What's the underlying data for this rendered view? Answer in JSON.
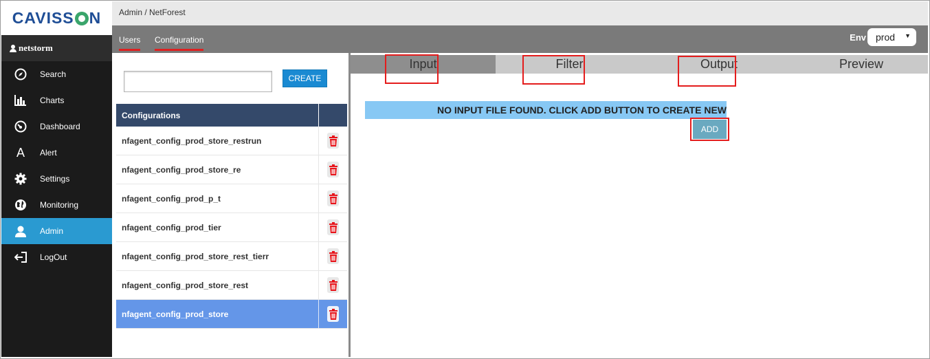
{
  "brand": {
    "logo_before": "CAVISS",
    "logo_after": "N"
  },
  "sidebar": {
    "user": "netstorm",
    "items": [
      {
        "label": "Search",
        "icon": "compass-icon"
      },
      {
        "label": "Charts",
        "icon": "bar-chart-icon"
      },
      {
        "label": "Dashboard",
        "icon": "dashboard-icon"
      },
      {
        "label": "Alert",
        "icon": "alert-icon"
      },
      {
        "label": "Settings",
        "icon": "gear-icon"
      },
      {
        "label": "Monitoring",
        "icon": "globe-icon"
      },
      {
        "label": "Admin",
        "icon": "user-icon",
        "active": true
      },
      {
        "label": "LogOut",
        "icon": "logout-icon"
      }
    ],
    "active_color": "#2a9ad1"
  },
  "header": {
    "breadcrumb": "Admin / NetForest",
    "tabs": [
      {
        "label": "Users"
      },
      {
        "label": "Configuration"
      }
    ],
    "env_label": "Env",
    "env_value": "prod"
  },
  "config_panel": {
    "name_input_value": "",
    "create_label": "CREATE",
    "table_header": "Configurations",
    "rows": [
      {
        "name": "nfagent_config_prod_store_restrun"
      },
      {
        "name": "nfagent_config_prod_store_re"
      },
      {
        "name": "nfagent_config_prod_p_t"
      },
      {
        "name": "nfagent_config_prod_tier"
      },
      {
        "name": "nfagent_config_prod_store_rest_tierr"
      },
      {
        "name": "nfagent_config_prod_store_rest"
      },
      {
        "name": "nfagent_config_prod_store",
        "selected": true
      }
    ]
  },
  "editor": {
    "tabs": [
      {
        "label": "Input",
        "active": true
      },
      {
        "label": "Filter"
      },
      {
        "label": "Output"
      },
      {
        "label": "Preview"
      }
    ],
    "empty_message": "NO INPUT FILE FOUND. CLICK ADD BUTTON TO CREATE NEW",
    "add_label": "ADD"
  },
  "colors": {
    "accent": "#1a8ad2",
    "highlight": "#e41c1c",
    "selected_row": "#6496e8",
    "table_header": "#34496a"
  }
}
